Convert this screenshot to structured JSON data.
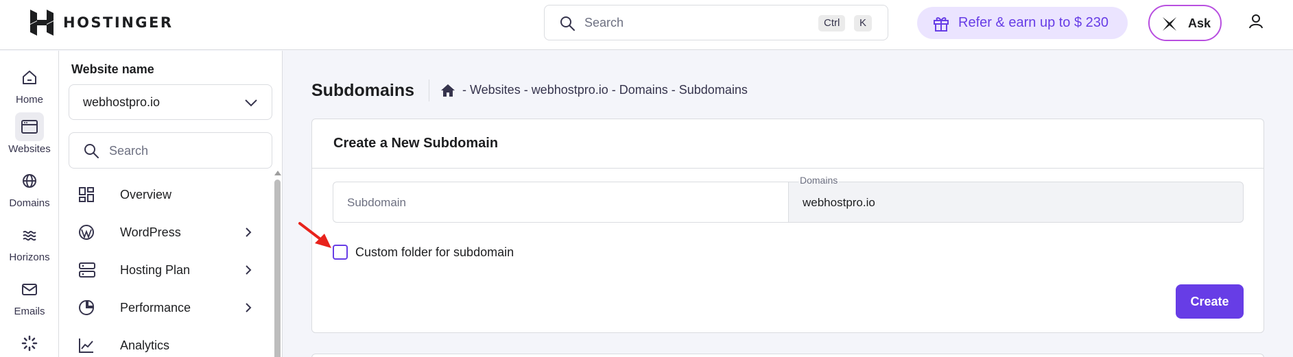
{
  "brand": {
    "name": "HOSTINGER"
  },
  "topbar": {
    "search_placeholder": "Search",
    "shortcut_keys": [
      "Ctrl",
      "K"
    ],
    "refer_label": "Refer & earn up to $ 230",
    "ask_label": "Ask"
  },
  "rail": {
    "items": [
      {
        "label": "Home",
        "icon": "home-icon"
      },
      {
        "label": "Websites",
        "icon": "browser-window-icon",
        "active": true
      },
      {
        "label": "Domains",
        "icon": "globe-icon"
      },
      {
        "label": "Horizons",
        "icon": "horizons-icon"
      },
      {
        "label": "Emails",
        "icon": "mail-icon"
      },
      {
        "label": "",
        "icon": "loading-icon"
      }
    ]
  },
  "sidebar": {
    "title": "Website name",
    "selected_site": "webhostpro.io",
    "search_placeholder": "Search",
    "items": [
      {
        "label": "Overview",
        "icon": "grid-icon",
        "has_arrow": false
      },
      {
        "label": "WordPress",
        "icon": "wordpress-icon",
        "has_arrow": true
      },
      {
        "label": "Hosting Plan",
        "icon": "server-icon",
        "has_arrow": true
      },
      {
        "label": "Performance",
        "icon": "pie-chart-icon",
        "has_arrow": true
      },
      {
        "label": "Analytics",
        "icon": "trend-chart-icon",
        "has_arrow": false
      }
    ]
  },
  "main": {
    "page_title": "Subdomains",
    "breadcrumb": "- Websites - webhostpro.io - Domains - Subdomains",
    "card": {
      "title": "Create a New Subdomain",
      "subdomain_placeholder": "Subdomain",
      "domains_label": "Domains",
      "domains_value": "webhostpro.io",
      "custom_folder_label": "Custom folder for subdomain",
      "custom_folder_checked": false,
      "create_label": "Create"
    }
  },
  "colors": {
    "accent": "#673de6",
    "refer_bg": "#ebe4ff",
    "page_bg": "#f4f5fa",
    "pointer_arrow": "#e8231c"
  }
}
